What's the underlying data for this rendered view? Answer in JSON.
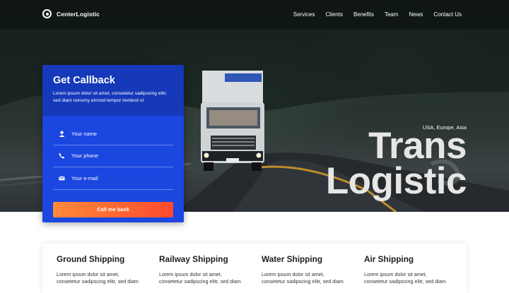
{
  "brand": {
    "name": "CenterLogistic",
    "icon": "logo-target-icon"
  },
  "nav": {
    "items": [
      "Services",
      "Clients",
      "Benefits",
      "Team",
      "News",
      "Contact Us"
    ]
  },
  "hero": {
    "regions": "USA, Europe, Asia",
    "title_line1": "Trans",
    "title_line2": "Logistic"
  },
  "callback": {
    "title": "Get Callback",
    "description": "Lorem ipsum dolor sit amet, consetetur sadipscing elitr, sed diam nonumy eirmod tempor invidunt ut",
    "fields": [
      {
        "placeholder": "Your name",
        "icon": "user-icon"
      },
      {
        "placeholder": "Your phone",
        "icon": "phone-icon"
      },
      {
        "placeholder": "Your e-mail",
        "icon": "mail-icon"
      }
    ],
    "submit_label": "Call me back"
  },
  "services": [
    {
      "title": "Ground Shipping",
      "text": "Lorem ipsum dolor sit amet,",
      "text2": "consetetur sadipscing elitr, sed diam"
    },
    {
      "title": "Railway Shipping",
      "text": "Lorem ipsum dolor sit amet,",
      "text2": "consetetur sadipscing elitr, sed diam"
    },
    {
      "title": "Water Shipping",
      "text": "Lorem ipsum dolor sit amet,",
      "text2": "consetetur sadipscing elitr, sed diam"
    },
    {
      "title": "Air Shipping",
      "text": "Lorem ipsum dolor sit amet,",
      "text2": "consetetur sadipscing elitr, sed diam"
    }
  ],
  "colors": {
    "accent_blue": "#1b46e0",
    "header_blue": "#1539b9",
    "button_orange": "#ff6a33"
  }
}
